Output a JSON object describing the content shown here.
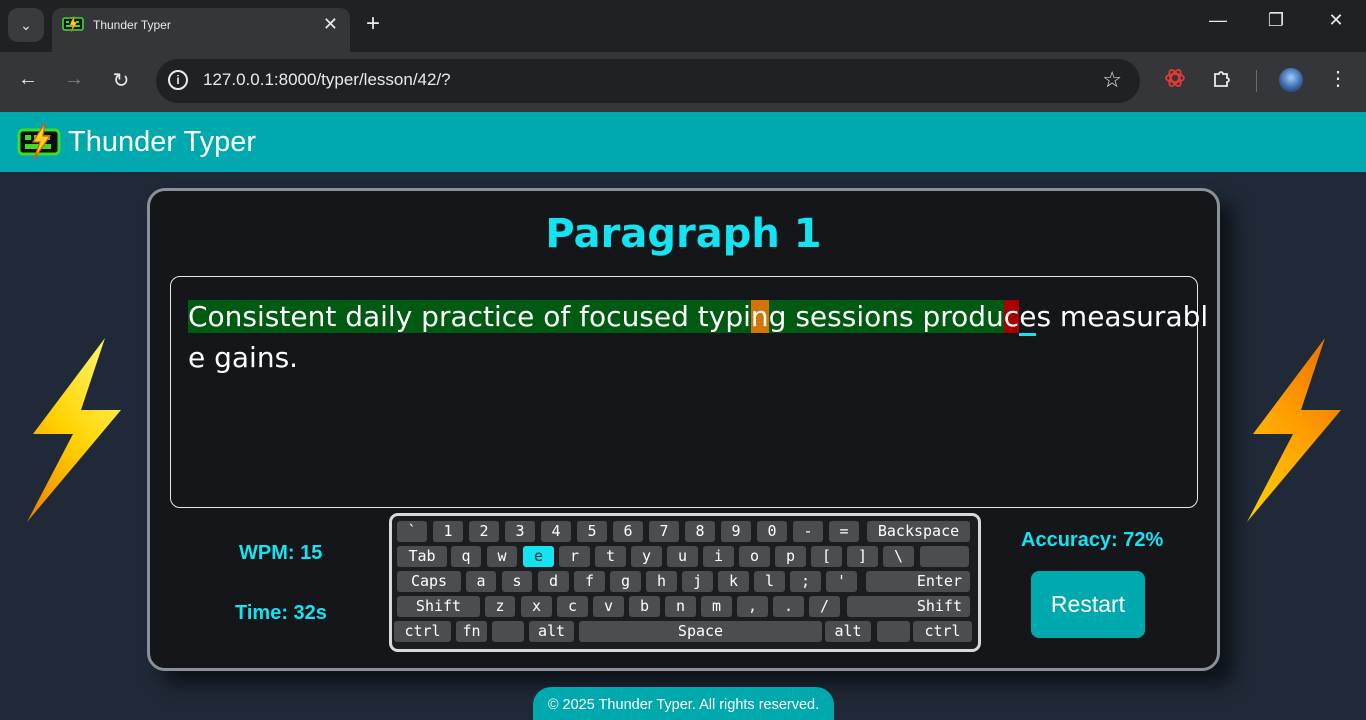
{
  "browser": {
    "tab_title": "Thunder Typer",
    "url": "127.0.0.1:8000/typer/lesson/42/?",
    "tab_close": "✕",
    "new_tab": "+",
    "minimize": "—",
    "restore": "❐",
    "close": "✕",
    "back": "←",
    "forward": "→",
    "reload": "↻",
    "info": "i",
    "star": "☆",
    "menu": "⋮",
    "tab_dropdown": "⌄",
    "extension_icons": [
      "openai-icon",
      "puzzle-extensions-icon"
    ]
  },
  "app": {
    "title": "Thunder Typer"
  },
  "lesson": {
    "title": "Paragraph 1",
    "line1": {
      "correct_1": "Consistent daily practice of focused typi",
      "corrected_1": "n",
      "correct_2": "g sessions produ",
      "wrong_1": "c",
      "pending_1": "e",
      "cursor_char": "s",
      "rest": " measurabl"
    },
    "line2": "e gains."
  },
  "stats": {
    "wpm": "WPM: 15",
    "time": "Time: 32s",
    "accuracy": "Accuracy: 72%",
    "restart": "Restart"
  },
  "keyboard": {
    "row1": [
      {
        "label": "`"
      },
      {
        "label": "1"
      },
      {
        "label": "2"
      },
      {
        "label": "3"
      },
      {
        "label": "4"
      },
      {
        "label": "5"
      },
      {
        "label": "6"
      },
      {
        "label": "7"
      },
      {
        "label": "8"
      },
      {
        "label": "9"
      },
      {
        "label": "0"
      },
      {
        "label": "-"
      },
      {
        "label": "="
      },
      {
        "label": "Backspace"
      }
    ],
    "row2": [
      {
        "label": "Tab"
      },
      {
        "label": "q"
      },
      {
        "label": "w"
      },
      {
        "label": "e",
        "active": true
      },
      {
        "label": "r"
      },
      {
        "label": "t"
      },
      {
        "label": "y"
      },
      {
        "label": "u"
      },
      {
        "label": "i"
      },
      {
        "label": "o"
      },
      {
        "label": "p"
      },
      {
        "label": "["
      },
      {
        "label": "]"
      },
      {
        "label": "\\"
      },
      {
        "label": ""
      }
    ],
    "row3": [
      {
        "label": "Caps"
      },
      {
        "label": "a"
      },
      {
        "label": "s"
      },
      {
        "label": "d"
      },
      {
        "label": "f"
      },
      {
        "label": "g"
      },
      {
        "label": "h"
      },
      {
        "label": "j"
      },
      {
        "label": "k"
      },
      {
        "label": "l"
      },
      {
        "label": ";"
      },
      {
        "label": "'"
      },
      {
        "label": "Enter"
      }
    ],
    "row4": [
      {
        "label": "Shift"
      },
      {
        "label": "z"
      },
      {
        "label": "x"
      },
      {
        "label": "c"
      },
      {
        "label": "v"
      },
      {
        "label": "b"
      },
      {
        "label": "n"
      },
      {
        "label": "m"
      },
      {
        "label": ","
      },
      {
        "label": "."
      },
      {
        "label": "/"
      },
      {
        "label": "Shift"
      }
    ],
    "row5": [
      {
        "label": "ctrl"
      },
      {
        "label": "fn"
      },
      {
        "label": ""
      },
      {
        "label": "alt"
      },
      {
        "label": "Space"
      },
      {
        "label": "alt"
      },
      {
        "label": ""
      },
      {
        "label": "ctrl"
      }
    ]
  },
  "footer": "© 2025 Thunder Typer. All rights reserved.",
  "colors": {
    "accent": "#00a9ad",
    "heading": "#14e3f2",
    "correct": "#005a12",
    "corrected": "#d47406",
    "wrong": "#a80000"
  }
}
